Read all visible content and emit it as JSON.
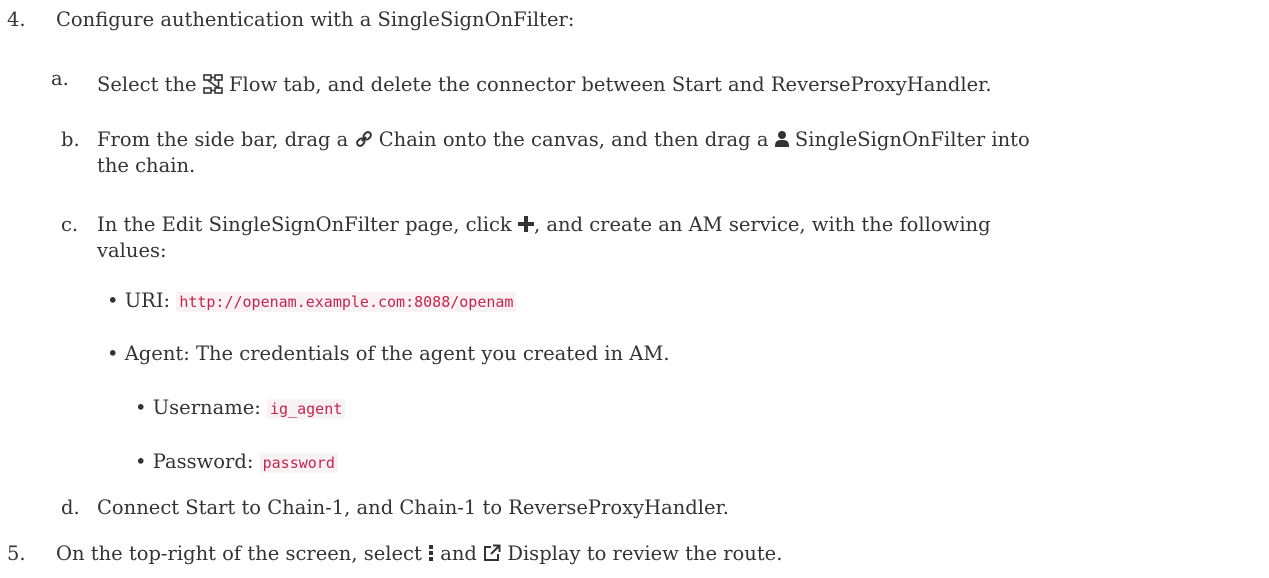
{
  "step4": {
    "number": "4.",
    "text": "Configure authentication with a SingleSignOnFilter:",
    "a": {
      "marker": "a.",
      "pre": "Select the",
      "icon": "flow-icon",
      "post": "Flow tab, and delete the connector between Start and ReverseProxyHandler."
    },
    "b": {
      "marker": "b.",
      "pre": "From the side bar, drag a",
      "icon1": "link-icon",
      "mid": "Chain onto the canvas, and then drag a",
      "icon2": "user-icon",
      "post": "SingleSignOnFilter into",
      "line2": "the chain."
    },
    "c": {
      "marker": "c.",
      "pre": "In the Edit SingleSignOnFilter page, click",
      "icon": "plus-icon",
      "post": ", and create an AM service, with the following",
      "line2": "values:",
      "uri_label": "URI:",
      "uri_value": "http://openam.example.com:8088/openam",
      "agent_text": "Agent: The credentials of the agent you created in AM.",
      "username_label": "Username:",
      "username_value": "ig_agent",
      "password_label": "Password:",
      "password_value": "password"
    },
    "d": {
      "marker": "d.",
      "text": "Connect Start to Chain-1, and Chain-1 to ReverseProxyHandler."
    }
  },
  "step5": {
    "number": "5.",
    "pre": "On the top-right of the screen, select",
    "icon1": "vertical-ellipsis-icon",
    "mid": "and",
    "icon2": "external-link-icon",
    "post": "Display to review the route."
  },
  "colors": {
    "text": "#333333",
    "code_text": "#c7254e",
    "code_bg": "#f9f2f4"
  }
}
